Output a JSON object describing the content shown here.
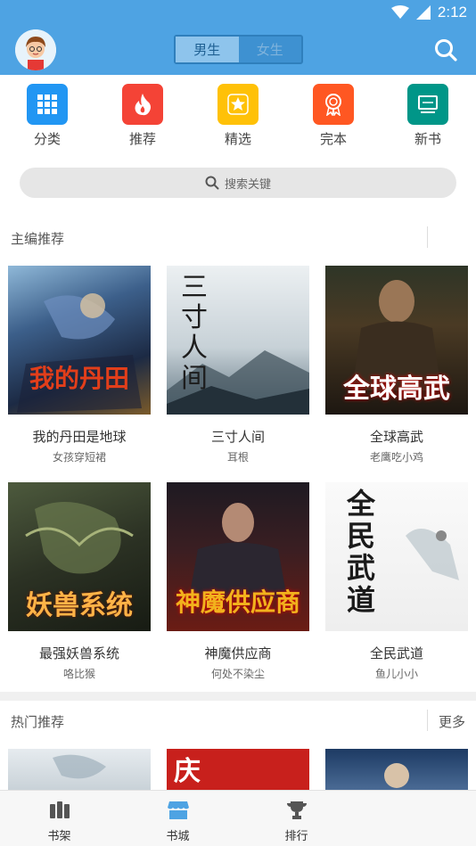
{
  "status": {
    "time": "2:12"
  },
  "header": {
    "tabs": [
      {
        "label": "男生",
        "active": true
      },
      {
        "label": "女生",
        "active": false
      }
    ]
  },
  "categories": [
    {
      "label": "分类",
      "icon": "grid-icon",
      "color": "#2196f3"
    },
    {
      "label": "推荐",
      "icon": "flame-icon",
      "color": "#f44336"
    },
    {
      "label": "精选",
      "icon": "star-icon",
      "color": "#ffc107"
    },
    {
      "label": "完本",
      "icon": "ribbon-icon",
      "color": "#ff5722"
    },
    {
      "label": "新书",
      "icon": "monitor-icon",
      "color": "#009688"
    }
  ],
  "search": {
    "placeholder": "搜索关键"
  },
  "editor_picks": {
    "title": "主编推荐",
    "books": [
      {
        "title": "我的丹田是地球",
        "author": "女孩穿短裙"
      },
      {
        "title": "三寸人间",
        "author": "耳根"
      },
      {
        "title": "全球高武",
        "author": "老鹰吃小鸡"
      },
      {
        "title": "最强妖兽系统",
        "author": "咯比猴"
      },
      {
        "title": "神魔供应商",
        "author": "何处不染尘"
      },
      {
        "title": "全民武道",
        "author": "鱼儿小小"
      }
    ]
  },
  "hot": {
    "title": "热门推荐",
    "more": "更多"
  },
  "bottom_nav": [
    {
      "label": "书架",
      "icon": "bookshelf-icon"
    },
    {
      "label": "书城",
      "icon": "store-icon",
      "active": true
    },
    {
      "label": "排行",
      "icon": "trophy-icon"
    }
  ],
  "colors": {
    "primary": "#4ea3e3"
  }
}
